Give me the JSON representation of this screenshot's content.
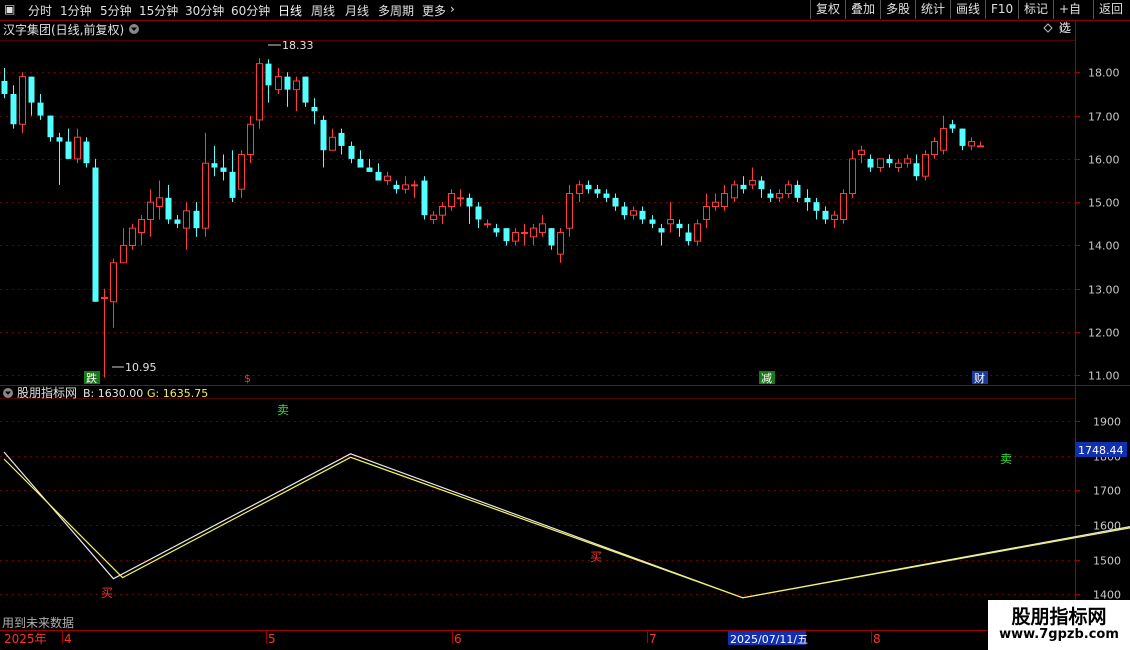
{
  "toolbar": {
    "left_tabs": [
      "分时",
      "1分钟",
      "5分钟",
      "15分钟",
      "30分钟",
      "60分钟",
      "日线",
      "周线",
      "月线",
      "多周期",
      "更多"
    ],
    "active_tab": "日线",
    "right_buttons": [
      "复权",
      "叠加",
      "多股",
      "统计",
      "画线",
      "F10",
      "标记",
      "+自选",
      "返回"
    ]
  },
  "main_panel": {
    "title": "汉字集团(日线,前复权)",
    "y_ticks": [
      "18.00",
      "17.00",
      "16.00",
      "15.00",
      "14.00",
      "13.00",
      "12.00",
      "11.00"
    ],
    "high_label": "18.33",
    "low_label": "10.95",
    "event_markers": [
      "跌",
      "$",
      "减",
      "财"
    ]
  },
  "indicator_panel": {
    "title": "股朋指标网",
    "b_label": "B: 1630.00",
    "g_label": "G: 1635.75",
    "current_value": "1748.44",
    "y_ticks": [
      "1900",
      "1800",
      "1700",
      "1600",
      "1500",
      "1400"
    ],
    "signals": [
      "卖",
      "买",
      "买",
      "卖"
    ],
    "footer_note": "用到未来数据"
  },
  "x_axis": {
    "labels": [
      "2025年",
      "4",
      "5",
      "6",
      "7",
      "8"
    ],
    "highlight_date": "2025/07/11/五"
  },
  "watermark": {
    "name": "股朋指标网",
    "url": "www.7gpzb.com"
  },
  "chart_data": [
    {
      "type": "candlestick",
      "y_range": [
        10.8,
        18.7
      ],
      "candles": [
        [
          17.8,
          18.1,
          17.4,
          17.5
        ],
        [
          17.5,
          17.7,
          16.7,
          16.8
        ],
        [
          16.8,
          18.0,
          16.6,
          17.9
        ],
        [
          17.9,
          17.9,
          17.0,
          17.3
        ],
        [
          17.3,
          17.5,
          16.9,
          17.0
        ],
        [
          17.0,
          17.0,
          16.4,
          16.5
        ],
        [
          16.5,
          16.6,
          15.4,
          16.4
        ],
        [
          16.4,
          16.7,
          16.0,
          16.0
        ],
        [
          16.0,
          16.7,
          15.9,
          16.5
        ],
        [
          16.4,
          16.5,
          15.8,
          15.9
        ],
        [
          15.8,
          16.0,
          12.7,
          12.7
        ],
        [
          12.8,
          13.0,
          10.95,
          12.8
        ],
        [
          12.7,
          13.7,
          12.1,
          13.6
        ],
        [
          13.6,
          14.4,
          13.8,
          14.0
        ],
        [
          14.0,
          14.5,
          13.9,
          14.4
        ],
        [
          14.3,
          14.7,
          14.0,
          14.6
        ],
        [
          14.6,
          15.3,
          14.2,
          15.0
        ],
        [
          14.9,
          15.5,
          14.6,
          15.1
        ],
        [
          15.1,
          15.4,
          14.5,
          14.6
        ],
        [
          14.6,
          14.7,
          14.4,
          14.5
        ],
        [
          14.4,
          15.0,
          13.9,
          14.8
        ],
        [
          14.8,
          15.0,
          14.2,
          14.4
        ],
        [
          14.4,
          16.6,
          14.2,
          15.9
        ],
        [
          15.9,
          16.3,
          15.6,
          15.8
        ],
        [
          15.8,
          16.1,
          15.5,
          15.7
        ],
        [
          15.7,
          16.2,
          15.0,
          15.1
        ],
        [
          15.3,
          16.2,
          15.1,
          16.1
        ],
        [
          16.1,
          17.0,
          15.9,
          16.8
        ],
        [
          16.9,
          18.33,
          16.7,
          18.2
        ],
        [
          18.2,
          18.3,
          17.3,
          17.7
        ],
        [
          17.6,
          18.1,
          17.5,
          17.9
        ],
        [
          17.9,
          18.0,
          17.2,
          17.6
        ],
        [
          17.6,
          17.9,
          17.1,
          17.8
        ],
        [
          17.9,
          17.9,
          17.2,
          17.3
        ],
        [
          17.2,
          17.4,
          16.8,
          17.1
        ],
        [
          16.9,
          17.0,
          15.8,
          16.2
        ],
        [
          16.2,
          16.7,
          16.2,
          16.5
        ],
        [
          16.6,
          16.7,
          16.1,
          16.3
        ],
        [
          16.3,
          16.4,
          15.9,
          16.0
        ],
        [
          16.0,
          16.2,
          15.8,
          15.8
        ],
        [
          15.8,
          16.0,
          15.7,
          15.7
        ],
        [
          15.7,
          15.9,
          15.5,
          15.5
        ],
        [
          15.5,
          15.7,
          15.4,
          15.6
        ],
        [
          15.4,
          15.5,
          15.2,
          15.3
        ],
        [
          15.3,
          15.6,
          15.2,
          15.4
        ],
        [
          15.4,
          15.5,
          15.1,
          15.4
        ],
        [
          15.5,
          15.6,
          14.6,
          14.7
        ],
        [
          14.6,
          14.8,
          14.5,
          14.7
        ],
        [
          14.7,
          15.0,
          14.5,
          14.9
        ],
        [
          14.9,
          15.3,
          14.8,
          15.2
        ],
        [
          15.1,
          15.3,
          14.9,
          15.1
        ],
        [
          15.1,
          15.2,
          14.5,
          14.9
        ],
        [
          14.9,
          15.0,
          14.4,
          14.6
        ],
        [
          14.5,
          14.6,
          14.4,
          14.5
        ],
        [
          14.4,
          14.5,
          14.2,
          14.3
        ],
        [
          14.4,
          14.4,
          14.0,
          14.1
        ],
        [
          14.1,
          14.4,
          14.0,
          14.3
        ],
        [
          14.3,
          14.5,
          14.0,
          14.3
        ],
        [
          14.2,
          14.5,
          14.0,
          14.4
        ],
        [
          14.3,
          14.7,
          14.2,
          14.5
        ],
        [
          14.4,
          14.4,
          13.9,
          14.0
        ],
        [
          13.8,
          14.4,
          13.6,
          14.3
        ],
        [
          14.4,
          15.4,
          14.2,
          15.2
        ],
        [
          15.2,
          15.5,
          15.0,
          15.4
        ],
        [
          15.4,
          15.5,
          15.2,
          15.3
        ],
        [
          15.3,
          15.4,
          15.1,
          15.2
        ],
        [
          15.2,
          15.3,
          15.0,
          15.1
        ],
        [
          15.1,
          15.2,
          14.8,
          14.9
        ],
        [
          14.9,
          15.0,
          14.6,
          14.7
        ],
        [
          14.7,
          14.9,
          14.6,
          14.8
        ],
        [
          14.8,
          14.9,
          14.5,
          14.6
        ],
        [
          14.6,
          14.7,
          14.4,
          14.5
        ],
        [
          14.4,
          14.5,
          14.0,
          14.3
        ],
        [
          14.5,
          15.0,
          14.3,
          14.6
        ],
        [
          14.5,
          14.6,
          14.2,
          14.4
        ],
        [
          14.3,
          14.5,
          14.0,
          14.1
        ],
        [
          14.1,
          14.6,
          14.0,
          14.5
        ],
        [
          14.6,
          15.2,
          14.4,
          14.9
        ],
        [
          14.9,
          15.2,
          14.8,
          15.0
        ],
        [
          14.9,
          15.4,
          14.8,
          15.2
        ],
        [
          15.1,
          15.5,
          15.0,
          15.4
        ],
        [
          15.4,
          15.6,
          15.2,
          15.3
        ],
        [
          15.4,
          15.8,
          15.3,
          15.5
        ],
        [
          15.5,
          15.6,
          15.1,
          15.3
        ],
        [
          15.2,
          15.3,
          15.0,
          15.1
        ],
        [
          15.1,
          15.3,
          15.0,
          15.2
        ],
        [
          15.2,
          15.5,
          15.1,
          15.4
        ],
        [
          15.4,
          15.5,
          15.0,
          15.1
        ],
        [
          15.1,
          15.3,
          14.8,
          15.0
        ],
        [
          15.0,
          15.1,
          14.6,
          14.8
        ],
        [
          14.8,
          14.9,
          14.5,
          14.6
        ],
        [
          14.6,
          14.8,
          14.4,
          14.7
        ],
        [
          14.6,
          15.3,
          14.5,
          15.2
        ],
        [
          15.2,
          16.2,
          15.1,
          16.0
        ],
        [
          16.1,
          16.3,
          15.9,
          16.2
        ],
        [
          16.0,
          16.1,
          15.7,
          15.8
        ],
        [
          15.8,
          16.0,
          15.7,
          16.0
        ],
        [
          16.0,
          16.1,
          15.8,
          15.9
        ],
        [
          15.8,
          16.0,
          15.7,
          15.9
        ],
        [
          15.9,
          16.1,
          15.8,
          16.0
        ],
        [
          15.9,
          16.1,
          15.5,
          15.6
        ],
        [
          15.6,
          16.2,
          15.5,
          16.1
        ],
        [
          16.1,
          16.5,
          16.0,
          16.4
        ],
        [
          16.2,
          17.0,
          16.1,
          16.7
        ],
        [
          16.8,
          16.9,
          16.6,
          16.7
        ],
        [
          16.7,
          16.7,
          16.2,
          16.3
        ],
        [
          16.3,
          16.5,
          16.2,
          16.4
        ],
        [
          16.3,
          16.4,
          16.3,
          16.3
        ]
      ]
    },
    {
      "type": "line",
      "y_range": [
        1300,
        1960
      ],
      "series": [
        {
          "name": "B",
          "color": "#e8e8e8",
          "points": [
            [
              0,
              1810
            ],
            [
              12,
              1445
            ],
            [
              38,
              1805
            ],
            [
              81,
              1390
            ],
            [
              140,
              1675
            ],
            [
              145,
              1630
            ]
          ]
        },
        {
          "name": "G",
          "color": "#f5f550",
          "points": [
            [
              0,
              1790
            ],
            [
              13,
              1448
            ],
            [
              38,
              1795
            ],
            [
              81,
              1390
            ],
            [
              140,
              1670
            ],
            [
              145,
              1635
            ]
          ]
        }
      ]
    }
  ]
}
